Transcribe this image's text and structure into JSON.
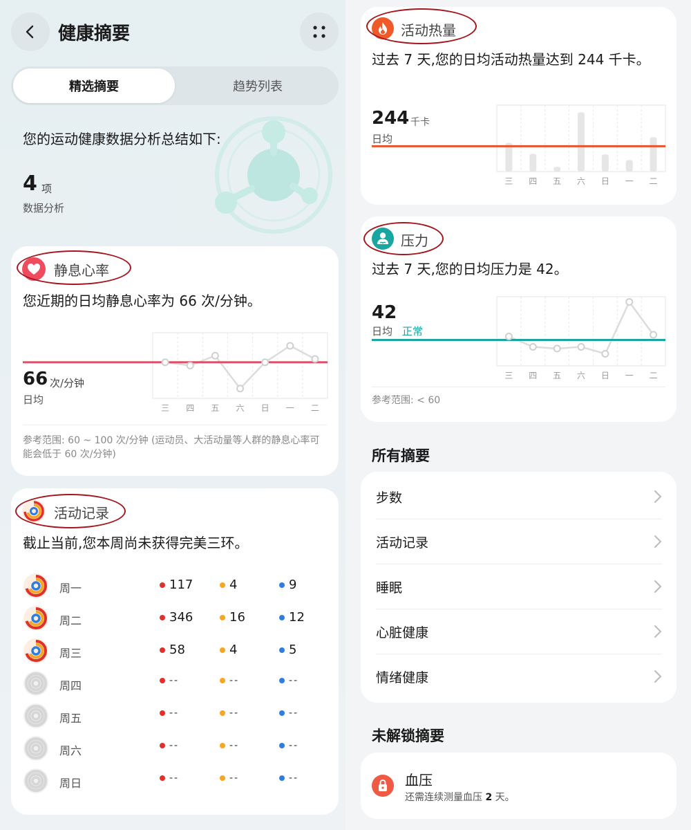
{
  "header": {
    "title": "健康摘要"
  },
  "tabs": [
    {
      "label": "精选摘要",
      "active": true
    },
    {
      "label": "趋势列表",
      "active": false
    }
  ],
  "summary": {
    "text": "您的运动健康数据分析总结如下:",
    "count": "4",
    "count_unit": "项",
    "count_label": "数据分析"
  },
  "heart": {
    "title": "静息心率",
    "body": "您近期的日均静息心率为 66 次/分钟。",
    "value": "66",
    "unit": "次/分钟",
    "avg_label": "日均",
    "reference": "参考范围: 60 ~ 100 次/分钟 (运动员、大活动量等人群的静息心率可能会低于 60 次/分钟)",
    "accent": "#e0506a"
  },
  "activity": {
    "title": "活动记录",
    "body": "截止当前,您本周尚未获得完美三环。",
    "rows": [
      {
        "day": "周一",
        "red": "117",
        "yellow": "4",
        "blue": "9",
        "active": true
      },
      {
        "day": "周二",
        "red": "346",
        "yellow": "16",
        "blue": "12",
        "active": true
      },
      {
        "day": "周三",
        "red": "58",
        "yellow": "4",
        "blue": "5",
        "active": true
      },
      {
        "day": "周四",
        "red": "--",
        "yellow": "--",
        "blue": "--",
        "active": false
      },
      {
        "day": "周五",
        "red": "--",
        "yellow": "--",
        "blue": "--",
        "active": false
      },
      {
        "day": "周六",
        "red": "--",
        "yellow": "--",
        "blue": "--",
        "active": false
      },
      {
        "day": "周日",
        "red": "--",
        "yellow": "--",
        "blue": "--",
        "active": false
      }
    ],
    "colors": {
      "red": "#e0302a",
      "yellow": "#f5a623",
      "blue": "#2f7de1"
    }
  },
  "calories": {
    "title": "活动热量",
    "body": "过去 7 天,您的日均活动热量达到 244 千卡。",
    "value": "244",
    "unit": "千卡",
    "avg_label": "日均",
    "accent": "#e8532d"
  },
  "stress": {
    "title": "压力",
    "body": "过去 7 天,您的日均压力是 42。",
    "value": "42",
    "avg_label": "日均",
    "status": "正常",
    "reference": "参考范围: < 60",
    "accent": "#1aa5a0"
  },
  "all_summaries": {
    "title": "所有摘要",
    "items": [
      "步数",
      "活动记录",
      "睡眠",
      "心脏健康",
      "情绪健康"
    ]
  },
  "locked": {
    "title": "未解锁摘要",
    "item_title": "血压",
    "item_sub_prefix": "还需连续测量血压",
    "item_sub_days": "2",
    "item_sub_suffix": "天。"
  },
  "chart_data": [
    {
      "type": "line",
      "categories": [
        "三",
        "四",
        "五",
        "六",
        "日",
        "一",
        "二"
      ],
      "values": [
        66,
        65,
        68,
        58,
        66,
        71,
        67
      ],
      "reference_line": 66,
      "ylim": [
        55,
        75
      ]
    },
    {
      "type": "bar",
      "categories": [
        "三",
        "四",
        "五",
        "六",
        "日",
        "一",
        "二"
      ],
      "values": [
        275,
        170,
        45,
        570,
        165,
        110,
        330
      ],
      "reference_line": 244,
      "ylim": [
        0,
        640
      ]
    },
    {
      "type": "line",
      "categories": [
        "三",
        "四",
        "五",
        "六",
        "日",
        "一",
        "二"
      ],
      "values": [
        42,
        36,
        35,
        36,
        32,
        62,
        43
      ],
      "reference_line": 40,
      "ylim": [
        25,
        65
      ]
    }
  ]
}
